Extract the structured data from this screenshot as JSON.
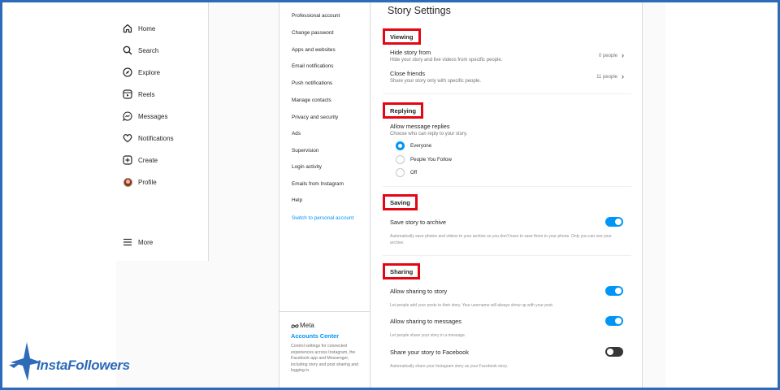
{
  "nav": {
    "items": [
      {
        "label": "Home",
        "icon": "home-icon"
      },
      {
        "label": "Search",
        "icon": "search-icon"
      },
      {
        "label": "Explore",
        "icon": "explore-icon"
      },
      {
        "label": "Reels",
        "icon": "reels-icon"
      },
      {
        "label": "Messages",
        "icon": "messages-icon"
      },
      {
        "label": "Notifications",
        "icon": "heart-icon"
      },
      {
        "label": "Create",
        "icon": "create-icon"
      },
      {
        "label": "Profile",
        "icon": "avatar"
      }
    ],
    "more": "More"
  },
  "menu": {
    "items": [
      "Professional account",
      "Change password",
      "Apps and websites",
      "Email notifications",
      "Push notifications",
      "Manage contacts",
      "Privacy and security",
      "Ads",
      "Supervision",
      "Login activity",
      "Emails from Instagram",
      "Help",
      "Switch to personal account"
    ],
    "meta": {
      "logo_text": "Meta",
      "accounts_center": "Accounts Center",
      "description": "Control settings for connected experiences across Instagram, the Facebook app and Messenger, including story and post sharing and logging in."
    }
  },
  "main": {
    "title": "Story Settings",
    "viewing": {
      "heading": "Viewing",
      "hide_story": {
        "title": "Hide story from",
        "subtitle": "Hide your story and live videos from specific people.",
        "value": "0 people"
      },
      "close_friends": {
        "title": "Close friends",
        "subtitle": "Share your story only with specific people.",
        "value": "11 people"
      }
    },
    "replying": {
      "heading": "Replying",
      "title": "Allow message replies",
      "subtitle": "Choose who can reply to your story.",
      "options": [
        "Everyone",
        "People You Follow",
        "Off"
      ],
      "selected": "Everyone"
    },
    "saving": {
      "heading": "Saving",
      "title": "Save story to archive",
      "enabled": true,
      "note": "Automatically save photos and videos to your archive so you don't have to save them to your phone. Only you can see your archive."
    },
    "sharing": {
      "heading": "Sharing",
      "story": {
        "title": "Allow sharing to story",
        "enabled": true,
        "note": "Let people add your posts to their story. Your username will always show up with your post."
      },
      "messages": {
        "title": "Allow sharing to messages",
        "enabled": true,
        "note": "Let people share your story in a message."
      },
      "facebook": {
        "title": "Share your story to Facebook",
        "enabled": false,
        "note": "Automatically share your Instagram story as your Facebook story."
      }
    }
  },
  "watermark": {
    "text": "InstaFollowers"
  },
  "colors": {
    "accent": "#0095f6",
    "highlight_box": "#e30613",
    "frame": "#2d6bb8"
  }
}
